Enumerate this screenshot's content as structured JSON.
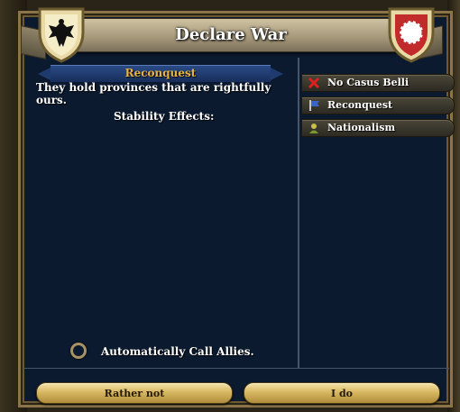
{
  "window": {
    "title": "Declare War"
  },
  "casus_belli": {
    "selected_title": "Reconquest",
    "description": "They hold provinces that are rightfully ours.",
    "stability_label": "Stability Effects:"
  },
  "cb_list": [
    {
      "label": "No Casus Belli",
      "icon": "red-x-icon"
    },
    {
      "label": "Reconquest",
      "icon": "blue-flag-icon"
    },
    {
      "label": "Nationalism",
      "icon": "nationalism-icon"
    }
  ],
  "options": {
    "call_allies_label": "Automatically Call Allies."
  },
  "buttons": {
    "cancel_label": "Rather not",
    "confirm_label": "I do"
  },
  "colors": {
    "panel_bg": "#0b1a2e",
    "subtitle_gold": "#e8b23c",
    "button_gold": "#d8b862"
  }
}
